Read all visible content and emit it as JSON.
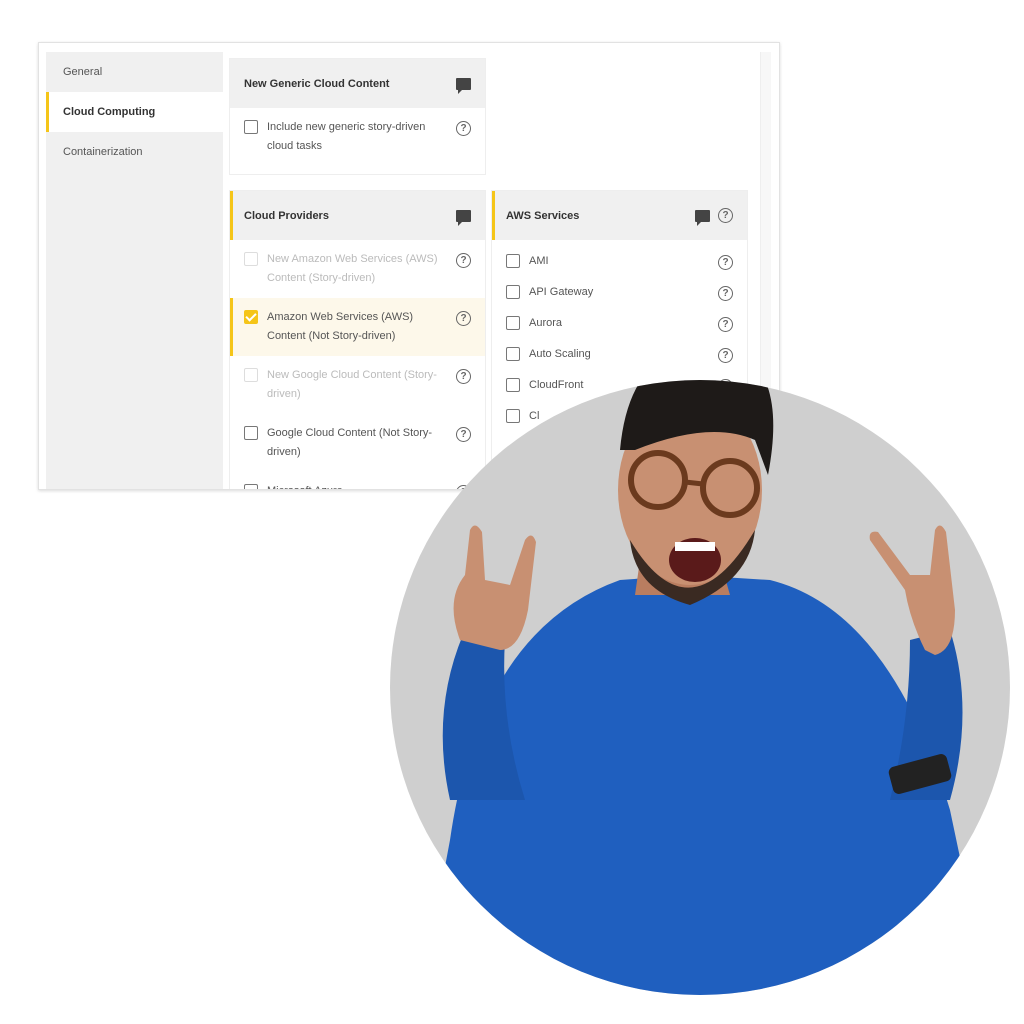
{
  "sidebar": {
    "items": [
      {
        "label": "General",
        "active": false
      },
      {
        "label": "Cloud Computing",
        "active": true
      },
      {
        "label": "Containerization",
        "active": false
      }
    ]
  },
  "generic_card": {
    "title": "New Generic Cloud Content",
    "items": [
      {
        "label": "Include new generic story-driven cloud tasks",
        "checked": false,
        "disabled": false
      }
    ]
  },
  "providers_card": {
    "title": "Cloud Providers",
    "items": [
      {
        "label": "New Amazon Web Services (AWS) Content (Story-driven)",
        "checked": false,
        "disabled": true
      },
      {
        "label": "Amazon Web Services (AWS) Content (Not Story-driven)",
        "checked": true,
        "disabled": false
      },
      {
        "label": "New Google Cloud Content (Story-driven)",
        "checked": false,
        "disabled": true
      },
      {
        "label": "Google Cloud Content (Not Story-driven)",
        "checked": false,
        "disabled": false
      },
      {
        "label": "Microsoft Azure",
        "checked": false,
        "disabled": false
      }
    ]
  },
  "aws_card": {
    "title": "AWS Services",
    "items": [
      {
        "label": "AMI"
      },
      {
        "label": "API Gateway"
      },
      {
        "label": "Aurora"
      },
      {
        "label": "Auto Scaling"
      },
      {
        "label": "CloudFront"
      },
      {
        "label": "Cl"
      }
    ]
  },
  "help_glyph": "?",
  "colors": {
    "accent": "#f5c518",
    "photo_bg": "#cfcfcf",
    "sweater": "#1f5fbf"
  }
}
